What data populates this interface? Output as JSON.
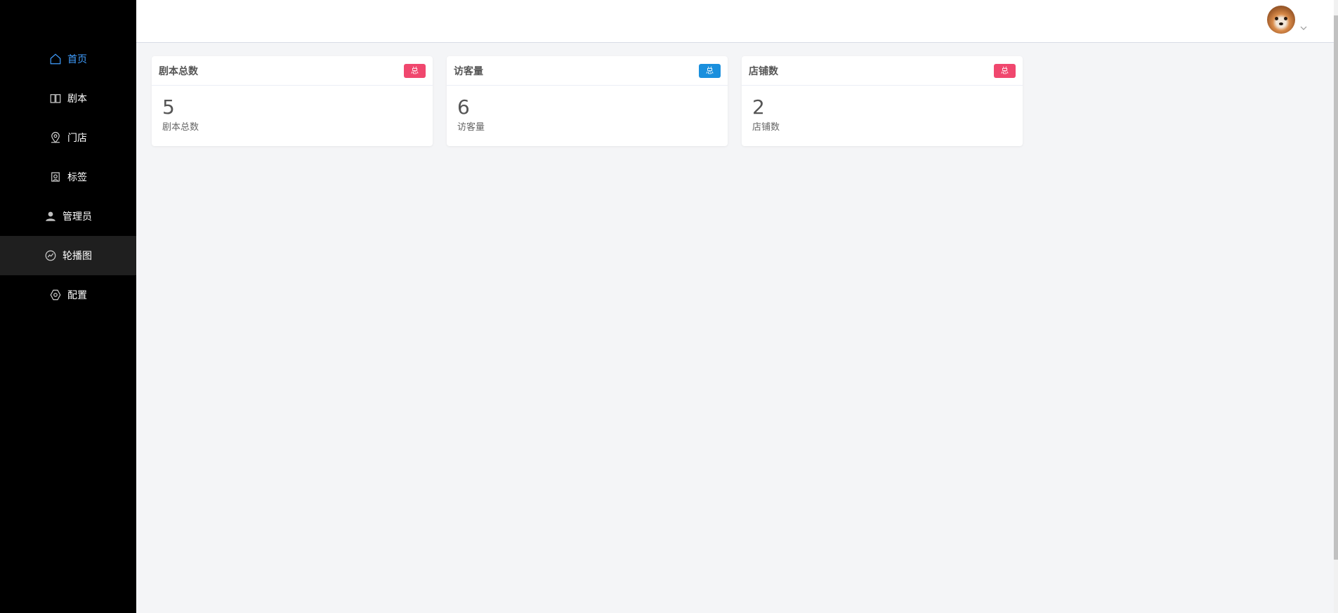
{
  "sidebar": {
    "items": [
      {
        "label": "首页",
        "icon": "home-icon",
        "active": true
      },
      {
        "label": "剧本",
        "icon": "book-icon",
        "active": false
      },
      {
        "label": "门店",
        "icon": "location-icon",
        "active": false
      },
      {
        "label": "标签",
        "icon": "tag-icon",
        "active": false
      },
      {
        "label": "管理员",
        "icon": "user-icon",
        "active": false
      },
      {
        "label": "轮播图",
        "icon": "chart-icon",
        "active": false
      },
      {
        "label": "配置",
        "icon": "gear-icon",
        "active": false
      }
    ]
  },
  "header": {
    "avatar_icon": "avatar"
  },
  "cards": [
    {
      "title": "剧本总数",
      "badge": "总",
      "badge_color": "#f0476e",
      "value": "5",
      "subtitle": "剧本总数"
    },
    {
      "title": "访客量",
      "badge": "总",
      "badge_color": "#1a8fdd",
      "value": "6",
      "subtitle": "访客量"
    },
    {
      "title": "店铺数",
      "badge": "总",
      "badge_color": "#f0476e",
      "value": "2",
      "subtitle": "店铺数"
    }
  ],
  "colors": {
    "sidebar_bg": "#000000",
    "accent": "#409eff",
    "page_bg": "#f4f5f7"
  }
}
